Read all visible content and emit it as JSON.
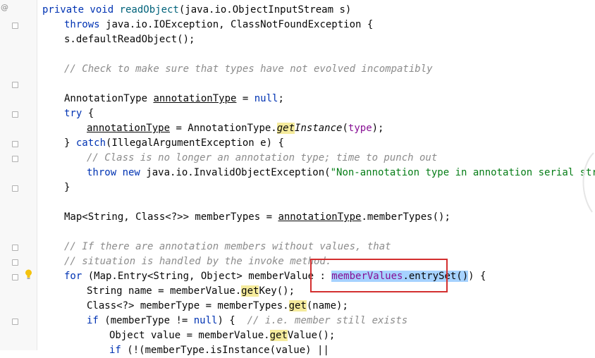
{
  "gutter": {
    "at_symbol": "@"
  },
  "code": {
    "l1": [
      "private void ",
      "readObject",
      "(java.io.ObjectInputStream s)"
    ],
    "l2": [
      "throws ",
      "java.io.IOException, ClassNotFoundException {"
    ],
    "l3": "s.defaultReadObject();",
    "l5": "// Check to make sure that types have not evolved incompatibly",
    "l7": [
      "AnnotationType ",
      "annotationType",
      " = ",
      "null",
      ";"
    ],
    "l8": [
      "try ",
      "{"
    ],
    "l9": [
      "annotationType",
      " = AnnotationType.",
      "get",
      "Instance",
      "(",
      "type",
      ");"
    ],
    "l10": [
      "} ",
      "catch",
      "(IllegalArgumentException e) {"
    ],
    "l11": "// Class is no longer an annotation type; time to punch out",
    "l12": [
      "throw new ",
      "java.io.InvalidObjectException(",
      "\"Non-annotation type in annotation serial stream\""
    ],
    "l13": "}",
    "l15": [
      "Map<String, Class<?>> memberTypes = ",
      "annotationType",
      ".memberTypes();"
    ],
    "l17": "// If there are annotation members without values, that",
    "l18": "// situation is handled by the invoke method.",
    "l19": [
      "for ",
      "(Map.Entry<String, Object> memberValue : ",
      "memberValues",
      ".entrySet()",
      ") {"
    ],
    "l20": [
      "String name = memberValue.",
      "get",
      "Key();"
    ],
    "l21": [
      "Class<?> memberType = memberTypes.",
      "get",
      "(name);"
    ],
    "l22": [
      "if ",
      "(memberType != ",
      "null",
      ") {  ",
      "// i.e. member still exists"
    ],
    "l23": [
      "Object value = memberValue.",
      "get",
      "Value();"
    ],
    "l24": [
      "if ",
      "(!(memberType.isInstance(value) ||"
    ]
  },
  "annotation": {
    "color": "#d32f2f"
  },
  "icons": {
    "intention": "lightbulb-icon",
    "fold": "fold-marker-icon"
  }
}
